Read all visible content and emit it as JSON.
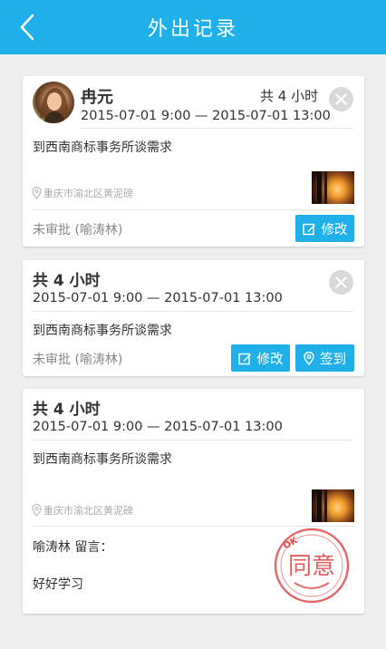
{
  "header": {
    "title": "外出记录",
    "back_icon": "chevron-left-icon",
    "bg_color": "#1fb0ea"
  },
  "records": [
    {
      "name": "冉元",
      "hours": "共 4 小时",
      "time_range": "2015-07-01 9:00 — 2015-07-01 13:00",
      "description": "到西南商标事务所谈需求",
      "location": "重庆市渝北区黄泥磅",
      "status": "未审批 (喻涛林)",
      "edit_label": "修改"
    },
    {
      "hours": "共 4 小时",
      "time_range": "2015-07-01 9:00 — 2015-07-01 13:00",
      "description": "到西南商标事务所谈需求",
      "status": "未审批 (喻涛林)",
      "edit_label": "修改",
      "checkin_label": "签到"
    },
    {
      "hours": "共 4 小时",
      "time_range": "2015-07-01 9:00 — 2015-07-01 13:00",
      "description": "到西南商标事务所谈需求",
      "location": "重庆市渝北区黄泥磅",
      "message_label": "喻涛林 留言：",
      "message_text": "好好学习",
      "stamp": {
        "top_text": "OK",
        "main_text": "同意"
      }
    }
  ]
}
